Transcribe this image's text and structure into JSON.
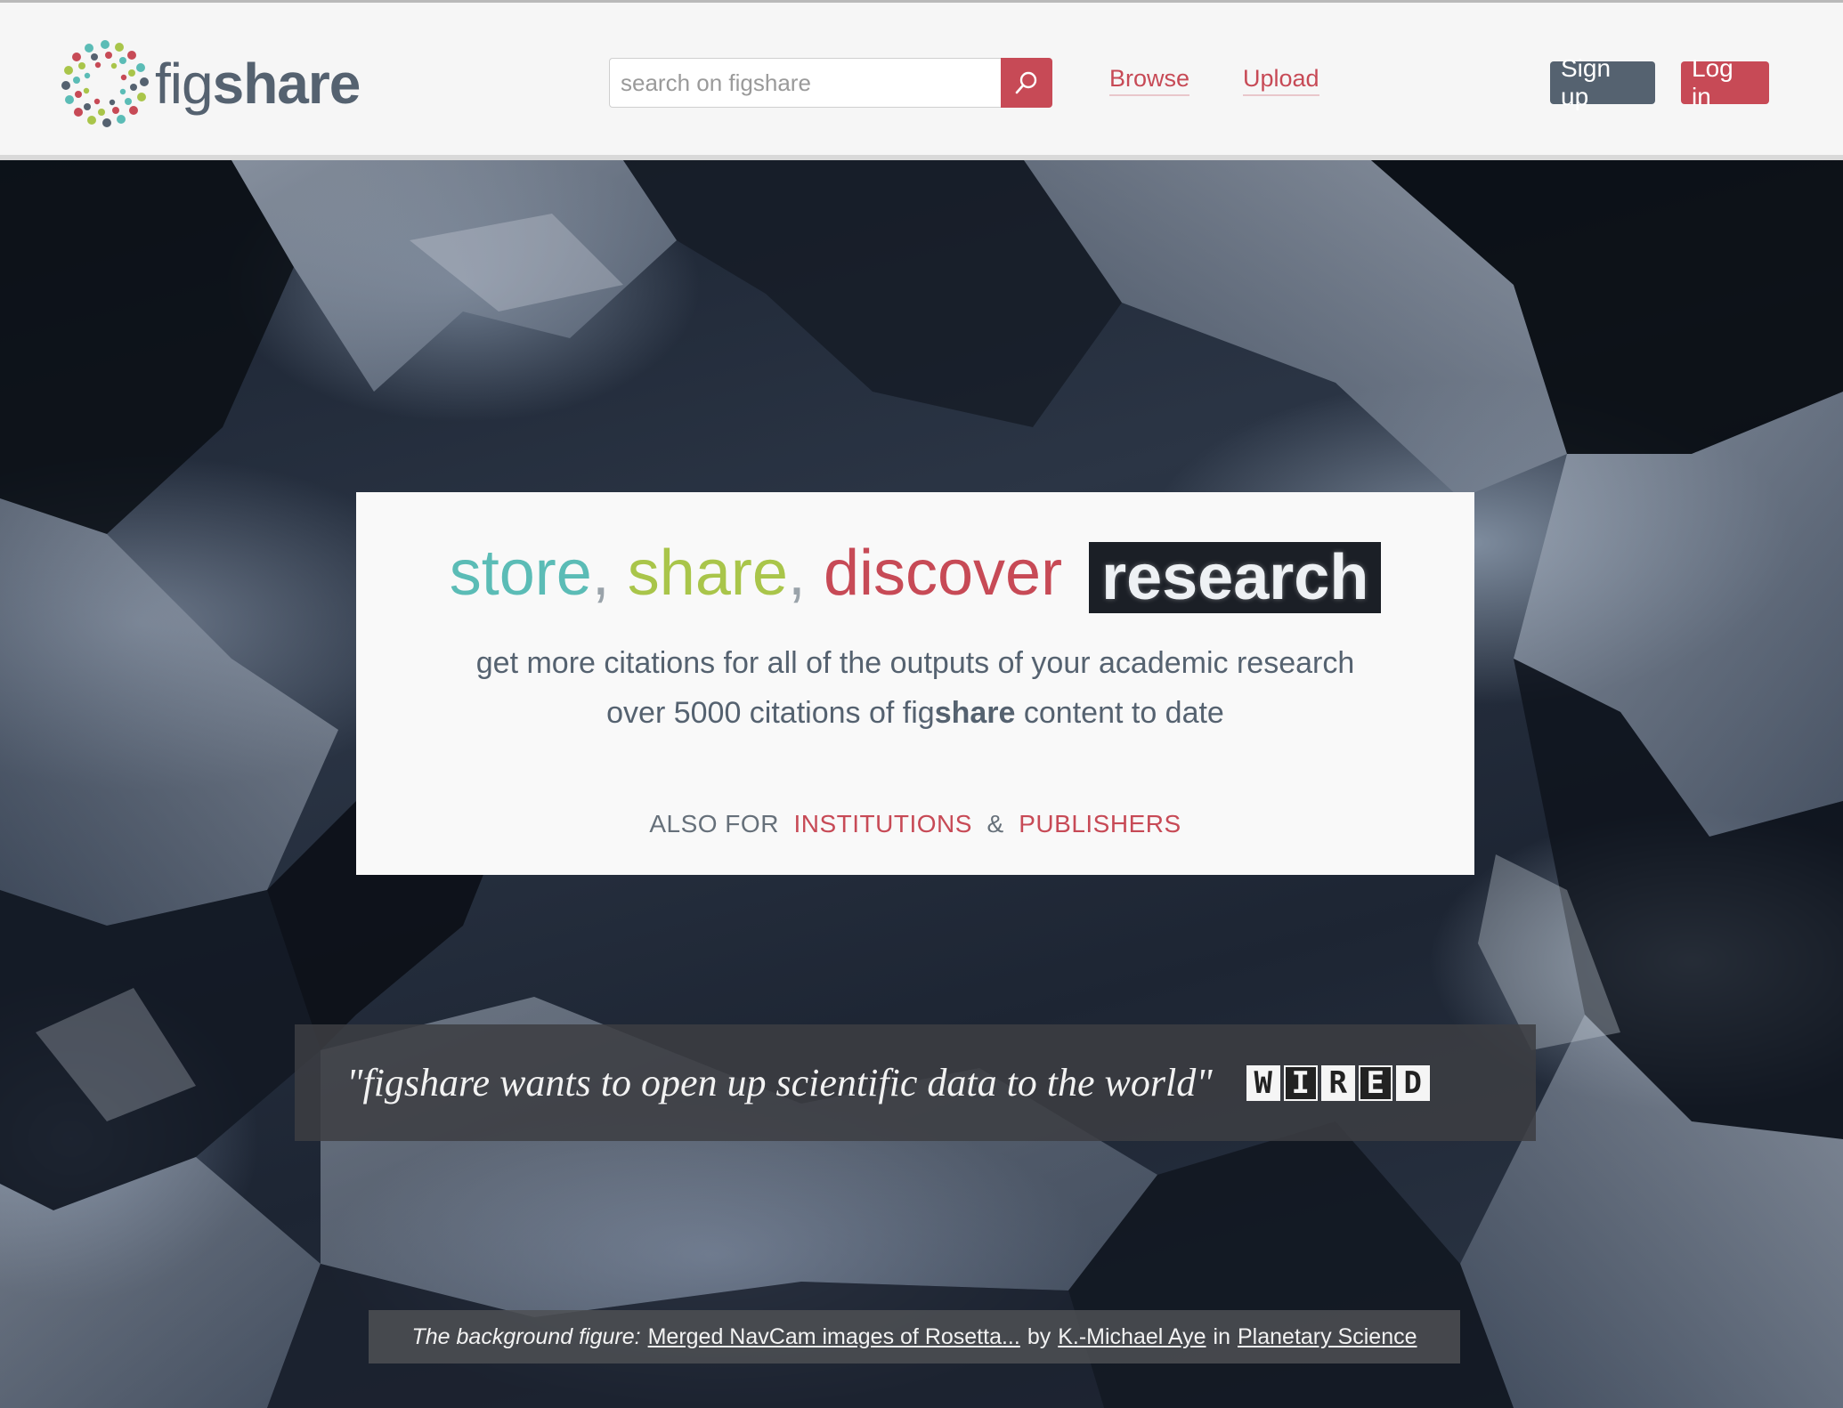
{
  "header": {
    "logo": {
      "text_light": "fig",
      "text_bold": "share"
    },
    "search": {
      "placeholder": "search on figshare"
    },
    "nav": {
      "browse": "Browse",
      "upload": "Upload"
    },
    "buttons": {
      "signup": "Sign up",
      "login": "Log in"
    },
    "colors": {
      "accent": "#c74a56",
      "slate": "#556270"
    }
  },
  "hero": {
    "headline": {
      "store": "store",
      "share": "share",
      "discover": "discover",
      "research": "research",
      "comma": ","
    },
    "subtitle_line1": "get more citations for all of the outputs of your academic research",
    "subtitle_line2_prefix": "over 5000 citations of fig",
    "subtitle_line2_bold": "share",
    "subtitle_line2_suffix": "content to date",
    "also": {
      "prefix": "ALSO FOR",
      "institutions": "INSTITUTIONS",
      "amp": "&",
      "publishers": "PUBLISHERS"
    },
    "quote": "\"figshare wants to open up scientific data to the world\"",
    "quote_source_letters": [
      "W",
      "I",
      "R",
      "E",
      "D"
    ],
    "caption": {
      "prefix": "The background figure:",
      "figure_link": "Merged NavCam images of Rosetta...",
      "by": "by",
      "author_link": "K.-Michael Aye",
      "in": "in",
      "category_link": "Planetary Science"
    },
    "colors": {
      "store": "#5bbcb6",
      "share": "#a9c54a",
      "discover": "#c74a56"
    }
  }
}
